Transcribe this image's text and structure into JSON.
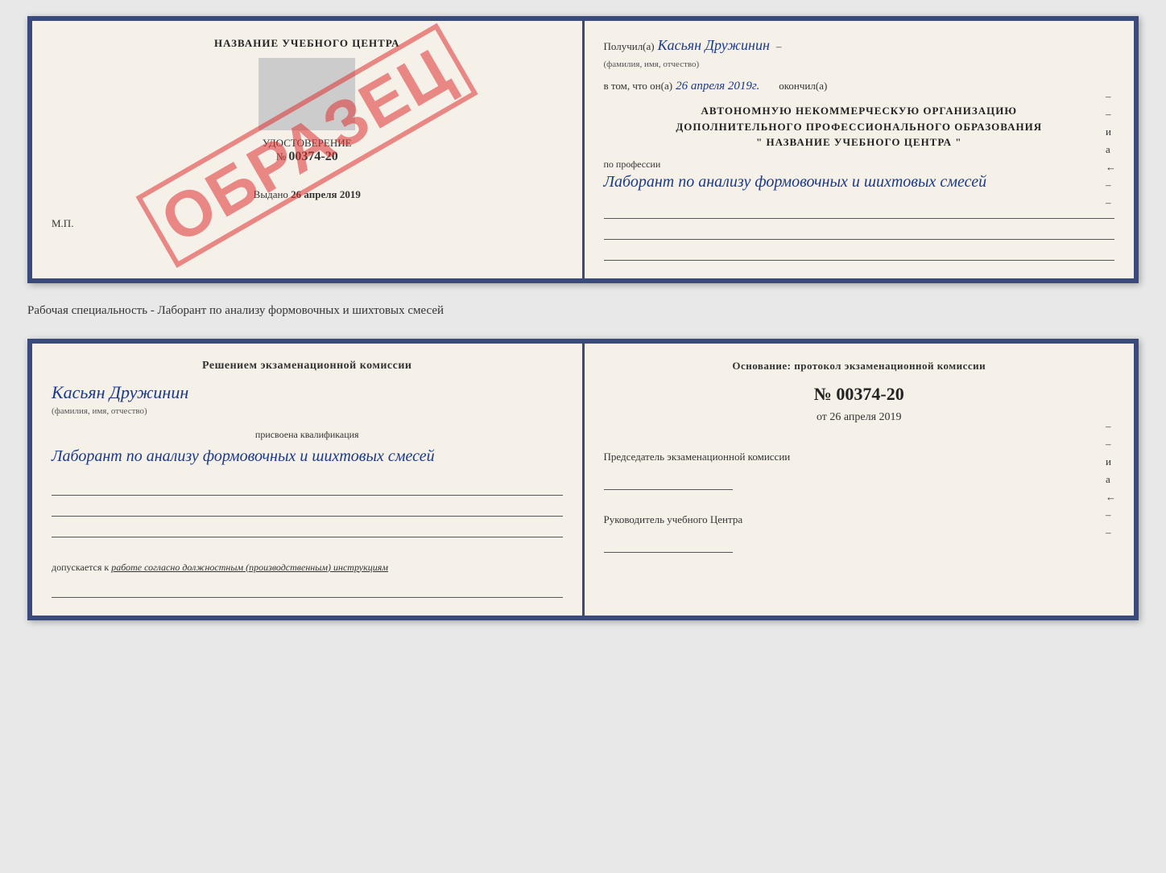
{
  "top_document": {
    "left": {
      "title": "НАЗВАНИЕ УЧЕБНОГО ЦЕНТРА",
      "cert_label": "УДОСТОВЕРЕНИЕ",
      "cert_number_prefix": "№",
      "cert_number": "00374-20",
      "issued_label": "Выдано",
      "issued_date": "26 апреля 2019",
      "mp_label": "М.П.",
      "watermark": "ОБРАЗЕЦ"
    },
    "right": {
      "received_label": "Получил(а)",
      "received_name": "Касьян Дружинин",
      "received_subtitle": "(фамилия, имя, отчество)",
      "in_that_label": "в том, что он(а)",
      "completion_date": "26 апреля 2019г.",
      "finished_label": "окончил(а)",
      "org_line1": "АВТОНОМНУЮ НЕКОММЕРЧЕСКУЮ ОРГАНИЗАЦИЮ",
      "org_line2": "ДОПОЛНИТЕЛЬНОГО ПРОФЕССИОНАЛЬНОГО ОБРАЗОВАНИЯ",
      "org_line3": "\" НАЗВАНИЕ УЧЕБНОГО ЦЕНТРА \"",
      "profession_label": "по профессии",
      "profession_handwritten": "Лаборант по анализу формовочных и шихтовых смесей",
      "margin_letters": "и а ←"
    }
  },
  "middle_text": "Рабочая специальность - Лаборант по анализу формовочных и шихтовых смесей",
  "bottom_document": {
    "left": {
      "commission_heading": "Решением экзаменационной комиссии",
      "name_handwritten": "Касьян Дружинин",
      "name_subtitle": "(фамилия, имя, отчество)",
      "qualification_label": "присвоена квалификация",
      "qualification_handwritten": "Лаборант по анализу формовочных и шихтовых смесей",
      "допускается_prefix": "допускается к",
      "допускается_text": "работе согласно должностным (производственным) инструкциям"
    },
    "right": {
      "osnov_label": "Основание: протокол экзаменационной комиссии",
      "protocol_number": "№ 00374-20",
      "protocol_date_prefix": "от",
      "protocol_date": "26 апреля 2019",
      "chairman_label": "Председатель экзаменационной комиссии",
      "director_label": "Руководитель учебного Центра",
      "margin_letters": "и а ←"
    }
  }
}
